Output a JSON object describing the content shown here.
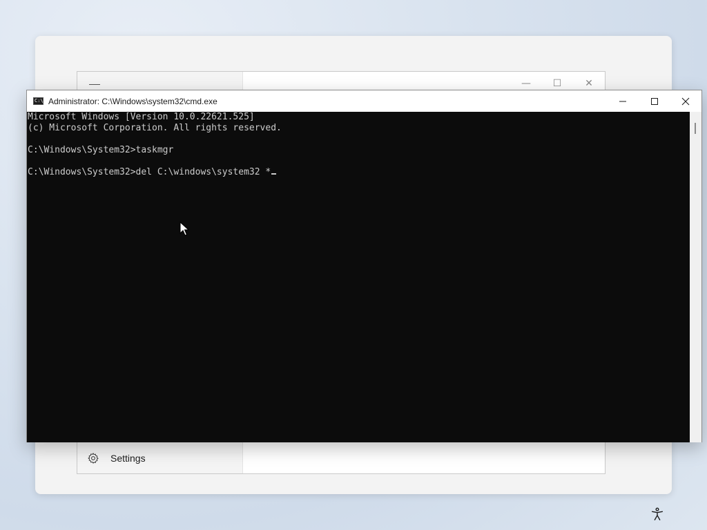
{
  "background_window": {
    "settings_label": "Settings",
    "min_glyph": "—",
    "max_glyph": "☐",
    "close_glyph": "✕"
  },
  "cmd": {
    "title": "Administrator: C:\\Windows\\system32\\cmd.exe",
    "icon_text": "C:\\",
    "lines": [
      "Microsoft Windows [Version 10.0.22621.525]",
      "(c) Microsoft Corporation. All rights reserved.",
      "",
      "C:\\Windows\\System32>taskmgr",
      "",
      "C:\\Windows\\System32>del C:\\windows\\system32 *"
    ]
  },
  "colors": {
    "console_bg": "#0c0c0c",
    "console_text": "#cccccc",
    "titlebar_bg": "#ffffff"
  },
  "icons": {
    "cmd": "cmd-icon",
    "minimize": "minimize-icon",
    "maximize": "maximize-icon",
    "close": "close-icon",
    "settings": "gear-icon",
    "accessibility": "accessibility-icon",
    "pointer": "mouse-pointer-icon"
  }
}
